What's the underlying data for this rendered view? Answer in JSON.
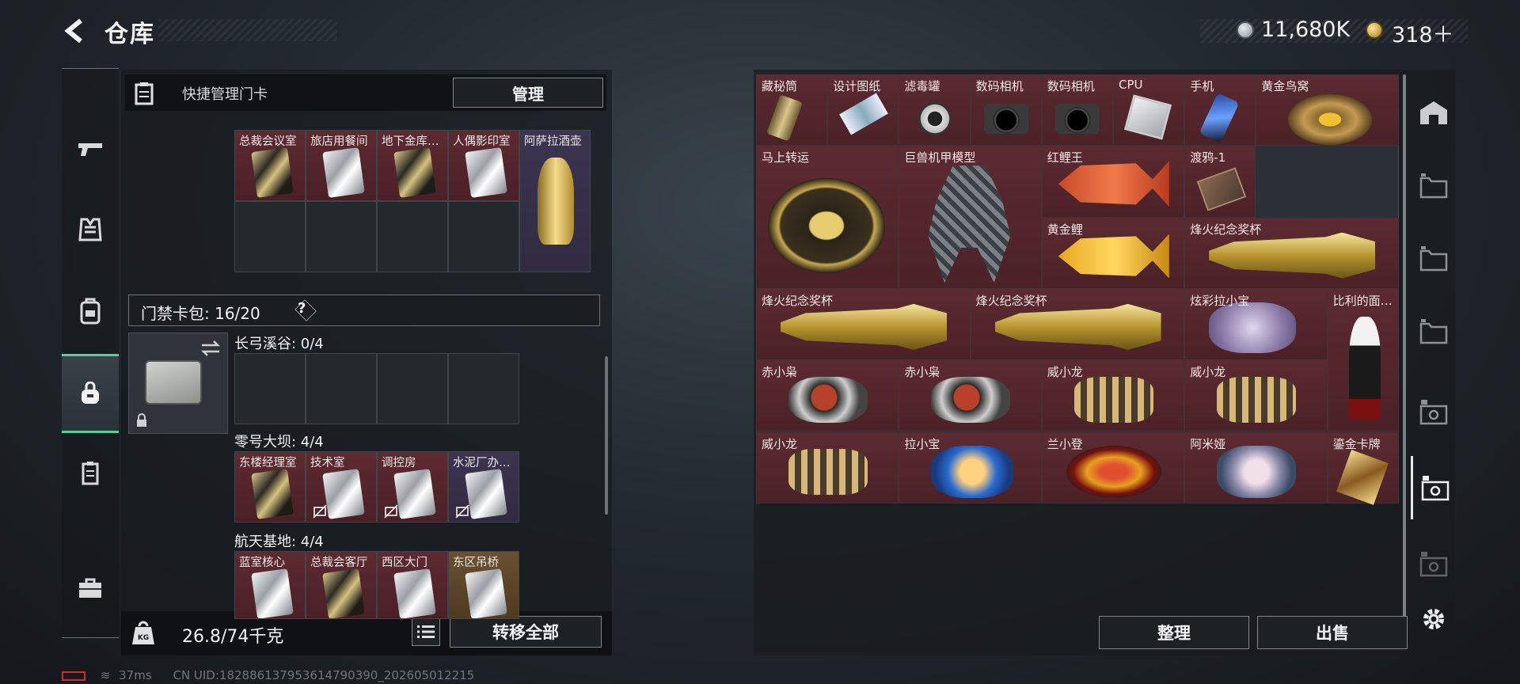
{
  "header": {
    "title": "仓库",
    "money": "11,680K",
    "gems": "318＋"
  },
  "left_nav": [
    "gun-icon",
    "armor-icon",
    "backpack-icon",
    "bag-icon",
    "cardcase-icon",
    "briefcase-icon"
  ],
  "quick": {
    "label": "快捷管理门卡",
    "manage": "管理"
  },
  "top_cards": [
    {
      "label": "总裁会议室",
      "style": "red",
      "card": "gold"
    },
    {
      "label": "旅店用餐间",
      "style": "red",
      "card": "white"
    },
    {
      "label": "地下金库…",
      "style": "red",
      "card": "gold"
    },
    {
      "label": "人偶影印室",
      "style": "red",
      "card": "white"
    },
    {
      "label": "阿萨拉酒壶",
      "style": "purple",
      "card": "jug"
    }
  ],
  "pack": {
    "label": "门禁卡包: 16/20",
    "help": "?"
  },
  "sections": [
    {
      "label": "长弓溪谷: 0/4",
      "cards": []
    },
    {
      "label": "零号大坝: 4/4",
      "cards": [
        {
          "label": "东楼经理室",
          "style": "red",
          "card": "gold",
          "crossed": false
        },
        {
          "label": "技术室",
          "style": "red",
          "card": "white",
          "crossed": true
        },
        {
          "label": "调控房",
          "style": "red",
          "card": "white",
          "crossed": true
        },
        {
          "label": "水泥厂办…",
          "style": "purple",
          "card": "white",
          "crossed": true
        }
      ]
    },
    {
      "label": "航天基地: 4/4",
      "cards": [
        {
          "label": "蓝室核心",
          "style": "red",
          "card": "white",
          "crossed": false
        },
        {
          "label": "总裁会客厅",
          "style": "red",
          "card": "gold",
          "crossed": false
        },
        {
          "label": "西区大门",
          "style": "red",
          "card": "white",
          "crossed": false
        },
        {
          "label": "东区吊桥",
          "style": "gold",
          "card": "white",
          "crossed": false
        }
      ]
    }
  ],
  "weight": {
    "value": "26.8/74千克",
    "transfer": "转移全部"
  },
  "items": [
    {
      "label": "藏秘筒",
      "col": 0,
      "row": 0,
      "w": 1,
      "h": 1,
      "art": "cylinder"
    },
    {
      "label": "设计图纸",
      "col": 1,
      "row": 0,
      "w": 1,
      "h": 1,
      "art": "paper"
    },
    {
      "label": "滤毒罐",
      "col": 2,
      "row": 0,
      "w": 1,
      "h": 1,
      "art": "canister"
    },
    {
      "label": "数码相机",
      "col": 3,
      "row": 0,
      "w": 1,
      "h": 1,
      "art": "camera"
    },
    {
      "label": "数码相机",
      "col": 4,
      "row": 0,
      "w": 1,
      "h": 1,
      "art": "camera"
    },
    {
      "label": "CPU",
      "col": 5,
      "row": 0,
      "w": 1,
      "h": 1,
      "art": "cpu"
    },
    {
      "label": "手机",
      "col": 6,
      "row": 0,
      "w": 1,
      "h": 1,
      "art": "phone"
    },
    {
      "label": "黄金鸟窝",
      "col": 7,
      "row": 0,
      "w": 2,
      "h": 1,
      "art": "nest"
    },
    {
      "label": "马上转运",
      "col": 0,
      "row": 1,
      "w": 2,
      "h": 2,
      "art": "disc"
    },
    {
      "label": "巨兽机甲模型",
      "col": 2,
      "row": 1,
      "w": 2,
      "h": 2,
      "art": "mech"
    },
    {
      "label": "红鲤王",
      "col": 4,
      "row": 1,
      "w": 2,
      "h": 1,
      "art": "redfish"
    },
    {
      "label": "渡鸦-1",
      "col": 6,
      "row": 1,
      "w": 1,
      "h": 1,
      "art": "box"
    },
    {
      "label": "黄金鲤",
      "col": 4,
      "row": 2,
      "w": 2,
      "h": 1,
      "art": "goldfish"
    },
    {
      "label": "烽火纪念奖杯",
      "col": 6,
      "row": 2,
      "w": 3,
      "h": 1,
      "art": "trophy"
    },
    {
      "label": "烽火纪念奖杯",
      "col": 0,
      "row": 3,
      "w": 3,
      "h": 1,
      "art": "trophy"
    },
    {
      "label": "烽火纪念奖杯",
      "col": 3,
      "row": 3,
      "w": 3,
      "h": 1,
      "art": "trophy"
    },
    {
      "label": "炫彩拉小宝",
      "col": 6,
      "row": 3,
      "w": 2,
      "h": 1,
      "art": "purplefig"
    },
    {
      "label": "比利的面…",
      "col": 8,
      "row": 3,
      "w": 1,
      "h": 2,
      "art": "billy"
    },
    {
      "label": "赤小枭",
      "col": 0,
      "row": 4,
      "w": 2,
      "h": 1,
      "art": "owl"
    },
    {
      "label": "赤小枭",
      "col": 2,
      "row": 4,
      "w": 2,
      "h": 1,
      "art": "owl"
    },
    {
      "label": "威小龙",
      "col": 4,
      "row": 4,
      "w": 2,
      "h": 1,
      "art": "dragon"
    },
    {
      "label": "威小龙",
      "col": 6,
      "row": 4,
      "w": 2,
      "h": 1,
      "art": "dragon"
    },
    {
      "label": "威小龙",
      "col": 0,
      "row": 5,
      "w": 2,
      "h": 1,
      "art": "dragon"
    },
    {
      "label": "拉小宝",
      "col": 2,
      "row": 5,
      "w": 2,
      "h": 1,
      "art": "bluefig"
    },
    {
      "label": "兰小登",
      "col": 4,
      "row": 5,
      "w": 2,
      "h": 1,
      "art": "sombrero"
    },
    {
      "label": "阿米娅",
      "col": 6,
      "row": 5,
      "w": 2,
      "h": 1,
      "art": "bunny"
    },
    {
      "label": "鎏金卡牌",
      "col": 8,
      "row": 5,
      "w": 1,
      "h": 1,
      "art": "goldcard"
    }
  ],
  "actions": {
    "sort": "整理",
    "sell": "出售"
  },
  "status": {
    "ping": "37ms",
    "uid": "CN UID:182886137953614790390_202605012215"
  }
}
